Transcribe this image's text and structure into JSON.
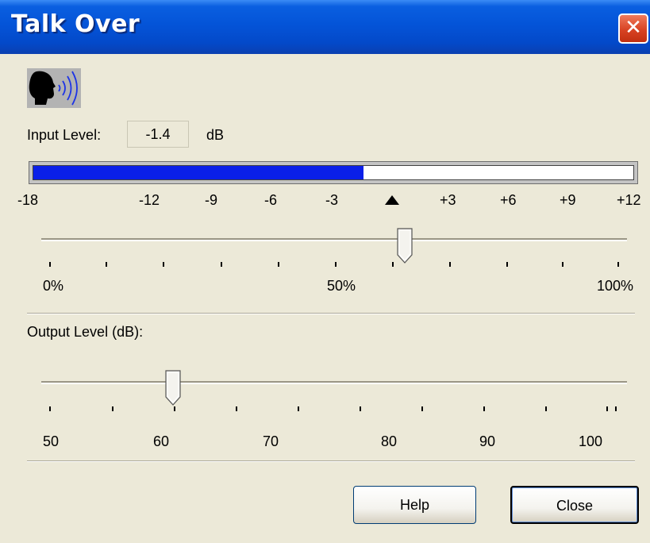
{
  "window": {
    "title": "Talk Over",
    "close_glyph": "✕"
  },
  "icons": {
    "talker": "person-speaking-icon",
    "close": "close-icon",
    "zero_marker": "triangle-up-icon"
  },
  "input": {
    "label": "Input Level:",
    "value": "-1.4",
    "unit": "dB",
    "meter_scale": [
      "-18",
      "-12",
      "-9",
      "-6",
      "-3",
      "+3",
      "+6",
      "+9",
      "+12"
    ],
    "meter_level_percent": 55,
    "threshold_scale": [
      "0%",
      "50%",
      "100%"
    ],
    "threshold_percent": 62
  },
  "output": {
    "label": "Output Level (dB):",
    "scale": [
      "50",
      "60",
      "70",
      "80",
      "90",
      "100"
    ],
    "value": 61
  },
  "buttons": {
    "help": "Help",
    "close": "Close"
  },
  "colors": {
    "meter_fill": "#0a1fe8",
    "title_bar": "#0454d8",
    "close_button": "#d84323",
    "dialog_bg": "#ece9d8"
  }
}
